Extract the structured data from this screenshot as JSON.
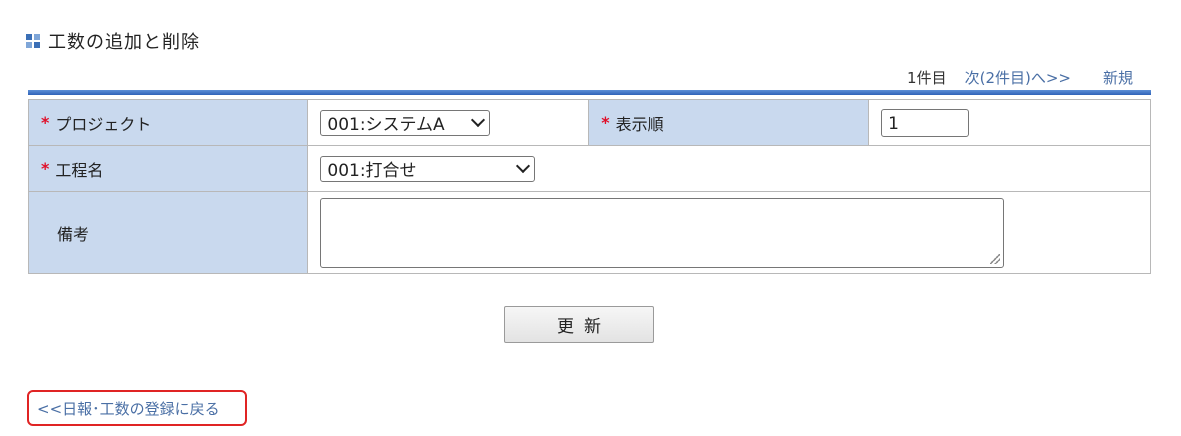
{
  "page": {
    "title": "工数の追加と削除"
  },
  "pager": {
    "current": "1件目",
    "next": "次(2件目)へ>>",
    "new": "新規"
  },
  "form": {
    "project": {
      "label": "プロジェクト",
      "required_mark": "*",
      "selected": "001:システムA"
    },
    "display_order": {
      "label": "表示順",
      "required_mark": "*",
      "value": "1"
    },
    "process_name": {
      "label": "工程名",
      "required_mark": "*",
      "selected": "001:打合せ"
    },
    "notes": {
      "label": "備考",
      "value": ""
    }
  },
  "actions": {
    "update_label": "更新"
  },
  "back_link": {
    "label": "<<日報･工数の登録に戻る"
  },
  "colors": {
    "label_bg": "#c9d9ee",
    "required": "#e0102a",
    "link": "#4a6fa5",
    "highlight_border": "#e02424",
    "header_bar": "#2f63b8"
  }
}
